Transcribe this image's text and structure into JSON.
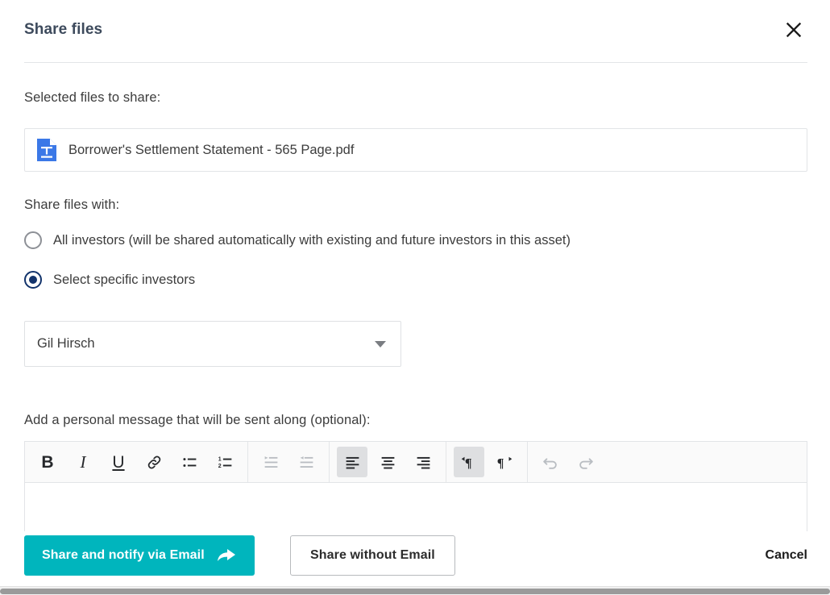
{
  "dialog": {
    "title": "Share files",
    "close_icon": "close-icon"
  },
  "selected_files": {
    "label": "Selected files to share:",
    "files": [
      {
        "name": "Borrower's Settlement Statement - 565 Page.pdf",
        "icon": "document-file-icon",
        "icon_color": "#3b78e7"
      }
    ]
  },
  "share_with": {
    "label": "Share files with:",
    "selected_index": 1,
    "accent_color": "#12336b",
    "options": [
      {
        "label": "All investors (will be shared automatically with existing and future investors in this asset)",
        "selected": false
      },
      {
        "label": "Select specific investors",
        "selected": true
      }
    ]
  },
  "investor_select": {
    "value": "Gil Hirsch",
    "placeholder": "Select investor",
    "caret_icon": "chevron-down-icon"
  },
  "message": {
    "label": "Add a personal message that will be sent along (optional):",
    "body_value": "",
    "body_placeholder": "",
    "toolbar_groups": [
      {
        "buttons": [
          {
            "name": "bold-icon",
            "glyph": "B",
            "state": "normal"
          },
          {
            "name": "italic-icon",
            "glyph": "I",
            "state": "normal"
          },
          {
            "name": "underline-icon",
            "glyph": "U",
            "state": "normal"
          },
          {
            "name": "link-icon",
            "glyph": "",
            "state": "normal"
          },
          {
            "name": "bulleted-list-icon",
            "glyph": "",
            "state": "normal"
          },
          {
            "name": "numbered-list-icon",
            "glyph": "",
            "state": "normal"
          }
        ]
      },
      {
        "buttons": [
          {
            "name": "indent-icon",
            "glyph": "",
            "state": "disabled"
          },
          {
            "name": "outdent-icon",
            "glyph": "",
            "state": "disabled"
          }
        ]
      },
      {
        "buttons": [
          {
            "name": "align-left-icon",
            "glyph": "",
            "state": "active"
          },
          {
            "name": "align-center-icon",
            "glyph": "",
            "state": "normal"
          },
          {
            "name": "align-right-icon",
            "glyph": "",
            "state": "normal"
          }
        ]
      },
      {
        "buttons": [
          {
            "name": "text-direction-ltr-icon",
            "glyph": "",
            "state": "active"
          },
          {
            "name": "text-direction-rtl-icon",
            "glyph": "",
            "state": "normal"
          }
        ]
      },
      {
        "buttons": [
          {
            "name": "undo-icon",
            "glyph": "",
            "state": "disabled"
          },
          {
            "name": "redo-icon",
            "glyph": "",
            "state": "disabled"
          }
        ]
      }
    ]
  },
  "footer": {
    "primary_label": "Share and notify via Email",
    "primary_icon": "share-arrow-icon",
    "primary_color": "#00b5bd",
    "secondary_label": "Share without Email",
    "cancel_label": "Cancel"
  }
}
